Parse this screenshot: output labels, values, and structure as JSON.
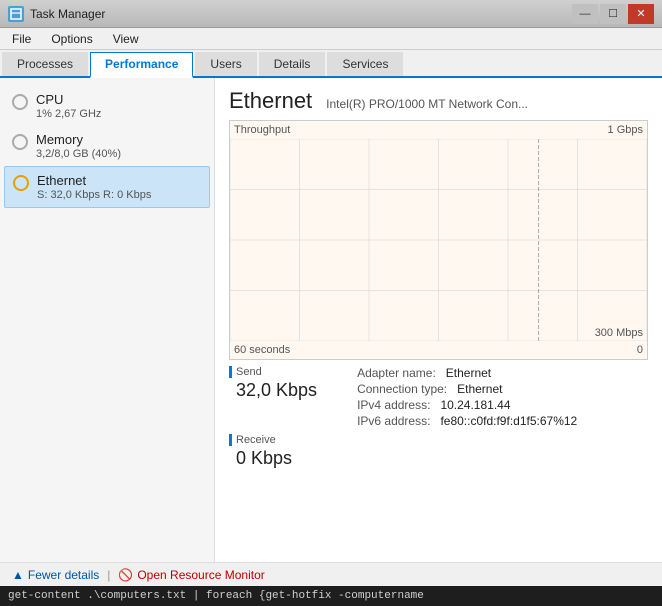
{
  "titlebar": {
    "title": "Task Manager",
    "icon": "TM",
    "min_label": "—",
    "max_label": "☐",
    "close_label": "✕"
  },
  "menubar": {
    "items": [
      "File",
      "Options",
      "View"
    ]
  },
  "tabs": {
    "items": [
      "Processes",
      "Performance",
      "Users",
      "Details",
      "Services"
    ],
    "active": "Performance"
  },
  "sidebar": {
    "items": [
      {
        "id": "cpu",
        "title": "CPU",
        "subtitle": "1% 2,67 GHz",
        "circle_style": "normal"
      },
      {
        "id": "memory",
        "title": "Memory",
        "subtitle": "3,2/8,0 GB (40%)",
        "circle_style": "normal"
      },
      {
        "id": "ethernet",
        "title": "Ethernet",
        "subtitle": "S: 32,0 Kbps  R: 0 Kbps",
        "circle_style": "orange",
        "active": true
      }
    ]
  },
  "content": {
    "title": "Ethernet",
    "subtitle": "Intel(R) PRO/1000 MT Network Con...",
    "chart": {
      "label_throughput": "Throughput",
      "label_top_right": "1 Gbps",
      "label_mid_right": "300 Mbps",
      "label_bottom_left": "60 seconds",
      "label_bottom_right": "0"
    },
    "send": {
      "label": "Send",
      "value": "32,0 Kbps"
    },
    "receive": {
      "label": "Receive",
      "value": "0 Kbps"
    },
    "info": {
      "adapter_name_label": "Adapter name:",
      "adapter_name_value": "Ethernet",
      "connection_type_label": "Connection type:",
      "connection_type_value": "Ethernet",
      "ipv4_label": "IPv4 address:",
      "ipv4_value": "10.24.181.44",
      "ipv6_label": "IPv6 address:",
      "ipv6_value": "fe80::c0fd:f9f:d1f5:67%12"
    }
  },
  "bottombar": {
    "fewer_details": "Fewer details",
    "separator": "|",
    "open_monitor": "Open Resource Monitor"
  },
  "terminal": {
    "text": "get-content .\\computers.txt | foreach {get-hotfix -computername"
  }
}
